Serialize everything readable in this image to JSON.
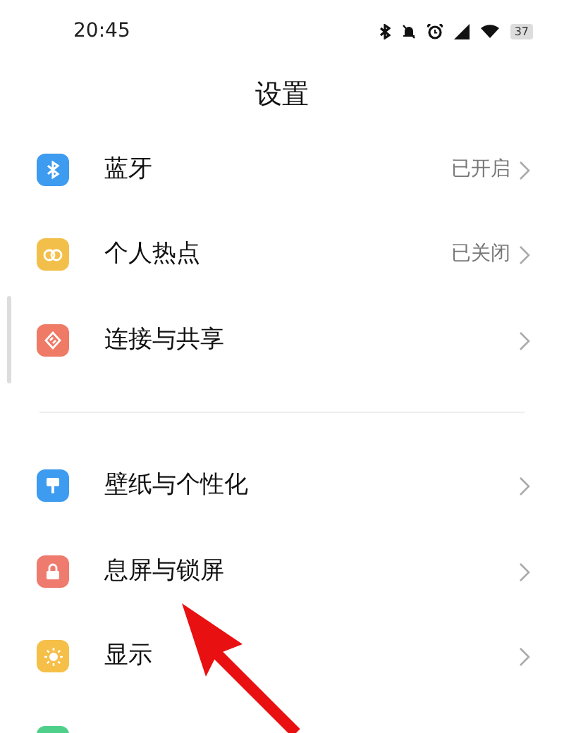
{
  "status_bar": {
    "time": "20:45",
    "battery": "37"
  },
  "title": "设置",
  "groups": [
    [
      {
        "label": "蓝牙",
        "value": "已开启",
        "color": "#3d9bf0"
      },
      {
        "label": "个人热点",
        "value": "已关闭",
        "color": "#f2c04a"
      },
      {
        "label": "连接与共享",
        "color": "#ef7a66"
      }
    ],
    [
      {
        "label": "壁纸与个性化",
        "color": "#3d9bf0"
      },
      {
        "label": "息屏与锁屏",
        "color": "#ef7a6e"
      },
      {
        "label": "显示",
        "color": "#f5bf48"
      },
      {
        "color": "#4fd08a"
      }
    ]
  ]
}
